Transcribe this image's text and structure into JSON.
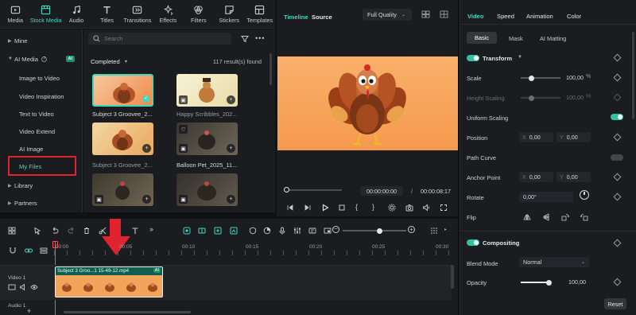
{
  "toolbar": {
    "tabs": [
      {
        "label": "Media",
        "icon": "media-icon"
      },
      {
        "label": "Stock Media",
        "icon": "stock-media-icon"
      },
      {
        "label": "Audio",
        "icon": "audio-icon"
      },
      {
        "label": "Titles",
        "icon": "titles-icon"
      },
      {
        "label": "Transitions",
        "icon": "transitions-icon"
      },
      {
        "label": "Effects",
        "icon": "effects-icon"
      },
      {
        "label": "Filters",
        "icon": "filters-icon"
      },
      {
        "label": "Stickers",
        "icon": "stickers-icon"
      },
      {
        "label": "Templates",
        "icon": "templates-icon"
      }
    ],
    "active_color": "#3fd9c2"
  },
  "sidebar": {
    "mine": "Mine",
    "ai_media": "AI Media",
    "ai_badge": "AI",
    "items": [
      "Image to Video",
      "Video Inspiration",
      "Text to Video",
      "Video Extend",
      "AI Image",
      "My Files"
    ],
    "library": "Library",
    "partners": "Partners"
  },
  "media": {
    "search_placeholder": "Search",
    "sort_label": "Completed",
    "result_count": "117 result(s) found",
    "items": [
      {
        "caption": "Subject 3 Groovee_2..."
      },
      {
        "caption": "Happy Scribbles_202..."
      },
      {
        "caption": "Subject 3 Groovee_2..."
      },
      {
        "caption": "Balloon Pet_2025_11..."
      },
      {
        "caption": ""
      },
      {
        "caption": ""
      }
    ]
  },
  "preview": {
    "tab_timeline": "Timeline",
    "tab_source": "Source",
    "quality": "Full Quality",
    "current_time": "00:00:00:00",
    "separator": "/",
    "total_time": "00:00:08:17"
  },
  "timeline": {
    "ruler": [
      "00:00",
      "00:05",
      "00:10",
      "00:15",
      "00:20",
      "00:25",
      "00:30"
    ],
    "clip_title": "Subject 3 Groo...1 15-49-12.mp4",
    "clip_badge": "AI",
    "video_track": "Video 1",
    "audio_track": "Audio 1"
  },
  "properties": {
    "tabs": [
      "Video",
      "Speed",
      "Animation",
      "Color"
    ],
    "subtabs": [
      "Basic",
      "Mask",
      "AI Matting"
    ],
    "transform": "Transform",
    "scale_label": "Scale",
    "scale_value": "100,00",
    "scale_unit": "%",
    "height_label": "Height Scaling",
    "height_value": "100,00",
    "height_unit": "%",
    "uniform_label": "Uniform Scaling",
    "position_label": "Position",
    "pos_x": "0,00",
    "pos_y": "0,00",
    "path_curve_label": "Path Curve",
    "anchor_label": "Anchor Point",
    "anchor_x": "0,00",
    "anchor_y": "0,00",
    "rotate_label": "Rotate",
    "rotate_value": "0,00°",
    "flip_label": "Flip",
    "compositing": "Compositing",
    "blend_label": "Blend Mode",
    "blend_value": "Normal",
    "opacity_label": "Opacity",
    "opacity_value": "100,00",
    "reset": "Reset",
    "x_label": "X",
    "y_label": "Y"
  }
}
